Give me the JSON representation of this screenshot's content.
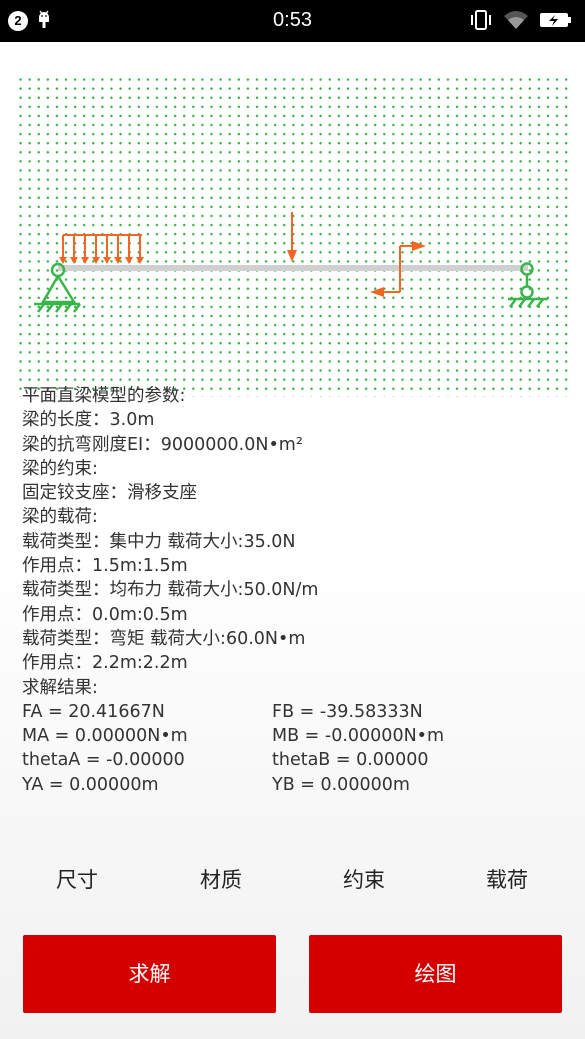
{
  "status_bar": {
    "notification_count": "2",
    "time": "0:53"
  },
  "info": {
    "heading": "平面直梁模型的参数:",
    "length": "梁的长度：3.0m",
    "stiffness": "梁的抗弯刚度EI：9000000.0N•m²",
    "constraint_heading": "梁的约束:",
    "constraint_value": "固定铰支座：滑移支座",
    "loads_heading": "梁的载荷:",
    "loads": [
      {
        "type": "载荷类型：集中力 载荷大小:35.0N",
        "point": "作用点：1.5m:1.5m"
      },
      {
        "type": "载荷类型：均布力 载荷大小:50.0N/m",
        "point": "作用点：0.0m:0.5m"
      },
      {
        "type": "载荷类型：弯矩 载荷大小:60.0N•m",
        "point": "作用点：2.2m:2.2m"
      }
    ],
    "results_heading": "求解结果:",
    "results": [
      [
        "FA = 20.41667N",
        "FB = -39.58333N"
      ],
      [
        "MA = 0.00000N•m",
        "MB = -0.00000N•m"
      ],
      [
        "thetaA = -0.00000",
        "thetaB = 0.00000"
      ],
      [
        "YA = 0.00000m",
        "YB = 0.00000m"
      ]
    ]
  },
  "tabs": [
    "尺寸",
    "材质",
    "约束",
    "载荷"
  ],
  "buttons": {
    "solve": "求解",
    "draw": "绘图"
  },
  "colors": {
    "accent": "#d40000",
    "grid_dot": "#39b54a",
    "load_arrow": "#f26522",
    "support": "#39b54a",
    "beam": "#d0d0d0"
  }
}
